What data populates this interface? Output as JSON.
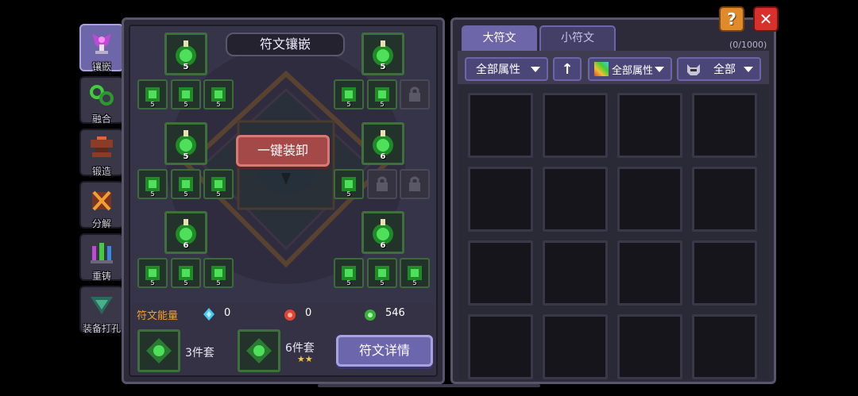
{
  "side_tabs": [
    {
      "label": "镶嵌",
      "icon": "rune-goblet-icon"
    },
    {
      "label": "融合",
      "icon": "fusion-rings-icon"
    },
    {
      "label": "锻造",
      "icon": "anvil-icon"
    },
    {
      "label": "分解",
      "icon": "decompose-icon"
    },
    {
      "label": "重铸",
      "icon": "recast-crystal-icon"
    },
    {
      "label": "装备打孔",
      "icon": "socket-drill-icon"
    }
  ],
  "left_panel": {
    "title": "符文镶嵌",
    "unequip_label": "一键装卸",
    "big_slots": [
      {
        "level": "5"
      },
      {
        "level": "5"
      },
      {
        "level": "5"
      },
      {
        "level": "6"
      },
      {
        "level": "6"
      },
      {
        "level": "6"
      }
    ],
    "small_slot_level": "5",
    "energy": {
      "label": "符文能量",
      "blue": "0",
      "red": "0",
      "green": "546"
    },
    "set3_label": "3件套",
    "set6_label": "6件套",
    "set6_stars": "★★",
    "details_label": "符文详情"
  },
  "right_panel": {
    "tabs": [
      "大符文",
      "小符文"
    ],
    "count": "(0/1000)",
    "filter_attr": "全部属性",
    "sort_arrow": "↑",
    "filter_color": "全部属性",
    "filter_type": "全部"
  },
  "buttons": {
    "help": "?",
    "close": "✕"
  },
  "colors": {
    "panel_bg": "#2d2b3a",
    "accent_purple": "#6d66a8",
    "rune_green": "#3ecf3a",
    "unequip_red": "#a44848",
    "energy_label": "#f0a030"
  }
}
